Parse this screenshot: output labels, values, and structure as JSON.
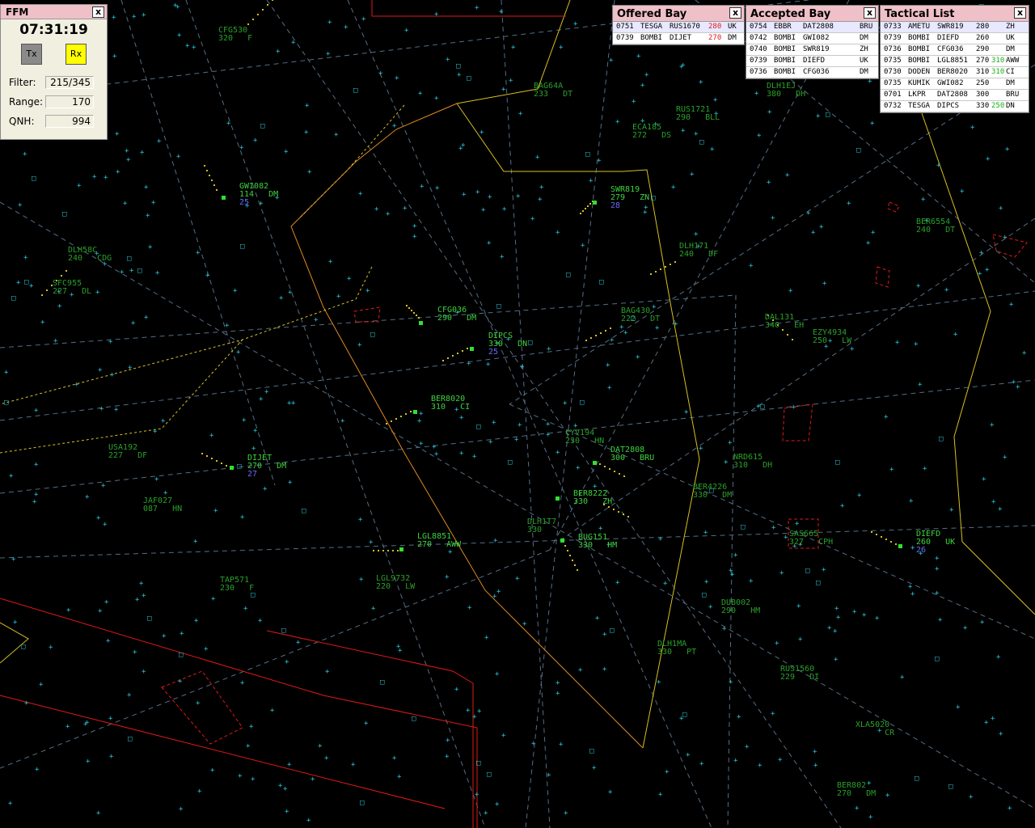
{
  "ffm": {
    "title": "FFM",
    "time": "07:31:19",
    "tx_label": "Tx",
    "rx_label": "Rx",
    "filter_label": "Filter:",
    "filter_value": "215/345",
    "range_label": "Range:",
    "range_value": "170",
    "qnh_label": "QNH:",
    "qnh_value": "994",
    "close": "x"
  },
  "offered": {
    "title": "Offered Bay",
    "close": "x",
    "rows": [
      {
        "id": "0751",
        "a": "TESGA",
        "b": "RUS1670",
        "lvl": "280",
        "sec": "UK"
      },
      {
        "id": "0739",
        "a": "BOMBI",
        "b": "DIJET",
        "lvl": "270",
        "sec": "DM"
      }
    ]
  },
  "accepted": {
    "title": "Accepted Bay",
    "close": "x",
    "rows": [
      {
        "id": "0754",
        "a": "EBBR",
        "b": "DAT2808",
        "lvl": "",
        "sec": "BRU"
      },
      {
        "id": "0742",
        "a": "BOMBI",
        "b": "GWI082",
        "lvl": "",
        "sec": "DM"
      },
      {
        "id": "0740",
        "a": "BOMBI",
        "b": "SWR819",
        "lvl": "",
        "sec": "ZH"
      },
      {
        "id": "0739",
        "a": "BOMBI",
        "b": "DIEFD",
        "lvl": "",
        "sec": "UK"
      },
      {
        "id": "0736",
        "a": "BOMBI",
        "b": "CFG036",
        "lvl": "",
        "sec": "DM"
      }
    ]
  },
  "tactical": {
    "title": "Tactical List",
    "close": "x",
    "rows": [
      {
        "id": "0733",
        "a": "AMETU",
        "b": "SWR819",
        "lvl": "280",
        "cfl": "",
        "sec": "ZH"
      },
      {
        "id": "0739",
        "a": "BOMBI",
        "b": "DIEFD",
        "lvl": "260",
        "cfl": "",
        "sec": "UK"
      },
      {
        "id": "0736",
        "a": "BOMBI",
        "b": "CFG036",
        "lvl": "290",
        "cfl": "",
        "sec": "DM"
      },
      {
        "id": "0735",
        "a": "BOMBI",
        "b": "LGL8851",
        "lvl": "270",
        "cfl": "310",
        "sec": "AWW"
      },
      {
        "id": "0730",
        "a": "DODEN",
        "b": "BER8020",
        "lvl": "310",
        "cfl": "310",
        "sec": "CI"
      },
      {
        "id": "0735",
        "a": "KUMIK",
        "b": "GWI082",
        "lvl": "250",
        "cfl": "",
        "sec": "DM"
      },
      {
        "id": "0701",
        "a": "LKPR",
        "b": "DAT2808",
        "lvl": "300",
        "cfl": "",
        "sec": "BRU"
      },
      {
        "id": "0732",
        "a": "TESGA",
        "b": "DIPCS",
        "lvl": "330",
        "cfl": "250",
        "sec": "DN"
      }
    ]
  },
  "tracks": [
    {
      "cs": "GWI082",
      "lvl": "114",
      "sec": "DM",
      "extra": "25"
    },
    {
      "cs": "SWR819",
      "lvl": "279",
      "sec": "ZN",
      "extra": "28"
    },
    {
      "cs": "CFG036",
      "lvl": "290",
      "sec": "DM",
      "extra": ""
    },
    {
      "cs": "DIPCS",
      "lvl": "330",
      "sec": "DN",
      "extra": "25"
    },
    {
      "cs": "BER8020",
      "lvl": "310",
      "sec": "CI",
      "extra": ""
    },
    {
      "cs": "DAT2808",
      "lvl": "300",
      "sec": "BRU",
      "extra": ""
    },
    {
      "cs": "DIJET",
      "lvl": "270",
      "sec": "DM",
      "extra": "27"
    },
    {
      "cs": "LGL8851",
      "lvl": "270",
      "sec": "AWW",
      "extra": ""
    },
    {
      "cs": "DIEFD",
      "lvl": "260",
      "sec": "UK",
      "extra": "26"
    },
    {
      "cs": "BUG151",
      "lvl": "330",
      "sec": "HM",
      "extra": ""
    },
    {
      "cs": "BER8222",
      "lvl": "330",
      "sec": "ZH",
      "extra": ""
    }
  ],
  "other_labels": [
    {
      "cs": "CFG530",
      "lvl": "320",
      "sec": "F"
    },
    {
      "cs": "BAG64A",
      "lvl": "233",
      "sec": "DT"
    },
    {
      "cs": "RUS1721",
      "lvl": "290",
      "sec": "BLL"
    },
    {
      "cs": "ECA185",
      "lvl": "272",
      "sec": "DS"
    },
    {
      "cs": "DLH1EJ",
      "lvl": "380",
      "sec": "DH"
    },
    {
      "cs": "DLH171",
      "lvl": "240",
      "sec": "DF"
    },
    {
      "cs": "BER6554",
      "lvl": "240",
      "sec": "DT"
    },
    {
      "cs": "DLH58C",
      "lvl": "240",
      "sec": "CDG"
    },
    {
      "cs": "SFC955",
      "lvl": "227",
      "sec": "DL"
    },
    {
      "cs": "BAG430",
      "lvl": "222",
      "sec": "DT"
    },
    {
      "cs": "DAL131",
      "lvl": "340",
      "sec": "EH"
    },
    {
      "cs": "EZY4934",
      "lvl": "250",
      "sec": "LW"
    },
    {
      "cs": "CYV194",
      "lvl": "230",
      "sec": "HN"
    },
    {
      "cs": "NRD615",
      "lvl": "310",
      "sec": "DH"
    },
    {
      "cs": "USA192",
      "lvl": "227",
      "sec": "DF"
    },
    {
      "cs": "JAF027",
      "lvl": "087",
      "sec": "HN"
    },
    {
      "cs": "BER4226",
      "lvl": "330",
      "sec": "DM"
    },
    {
      "cs": "DLH1T7",
      "lvl": "330",
      "sec": ""
    },
    {
      "cs": "SAS665",
      "lvl": "327",
      "sec": "CPH"
    },
    {
      "cs": "TAP571",
      "lvl": "230",
      "sec": "F"
    },
    {
      "cs": "LGL9732",
      "lvl": "220",
      "sec": "LW"
    },
    {
      "cs": "DUB002",
      "lvl": "290",
      "sec": "HM"
    },
    {
      "cs": "DLH1MA",
      "lvl": "330",
      "sec": "PT"
    },
    {
      "cs": "RUS1560",
      "lvl": "229",
      "sec": "DI"
    },
    {
      "cs": "XLA5020",
      "lvl": "",
      "sec": "CR"
    },
    {
      "cs": "BER802",
      "lvl": "270",
      "sec": "DM"
    }
  ],
  "colors": {
    "background": "#000000",
    "label": "#3fd23f",
    "fix": "#29c6d8",
    "sector": "#d8c020",
    "restricted": "#e01818",
    "panel_title": "#f0c0c8"
  }
}
